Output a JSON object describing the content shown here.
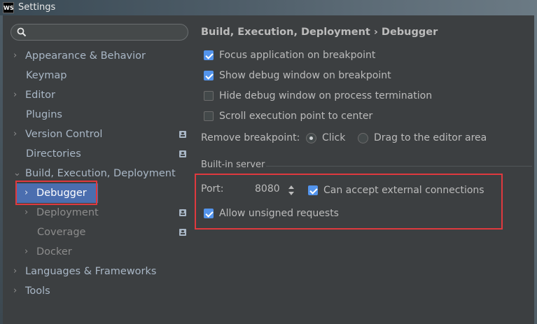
{
  "window": {
    "title": "Settings",
    "logo_text": "WS"
  },
  "search": {
    "placeholder": ""
  },
  "sidebar": {
    "items": [
      {
        "label": "Appearance & Behavior",
        "chevron": "›"
      },
      {
        "label": "Keymap"
      },
      {
        "label": "Editor",
        "chevron": "›"
      },
      {
        "label": "Plugins"
      },
      {
        "label": "Version Control",
        "chevron": "›"
      },
      {
        "label": "Directories"
      },
      {
        "label": "Build, Execution, Deployment",
        "chevron": "⌄"
      },
      {
        "label": "Debugger",
        "chevron": "›"
      },
      {
        "label": "Deployment",
        "chevron": "›"
      },
      {
        "label": "Coverage"
      },
      {
        "label": "Docker",
        "chevron": "›"
      },
      {
        "label": "Languages & Frameworks",
        "chevron": "›"
      },
      {
        "label": "Tools",
        "chevron": "›"
      }
    ]
  },
  "content": {
    "breadcrumb": "Build, Execution, Deployment › Debugger",
    "checkboxes": [
      {
        "label": "Focus application on breakpoint",
        "checked": true
      },
      {
        "label": "Show debug window on breakpoint",
        "checked": true
      },
      {
        "label": "Hide debug window on process termination",
        "checked": false
      },
      {
        "label": "Scroll execution point to center",
        "checked": false
      }
    ],
    "remove_breakpoint": {
      "label": "Remove breakpoint:",
      "options": [
        "Click",
        "Drag to the editor area"
      ],
      "selected": "Click"
    },
    "builtin_server": {
      "title": "Built-in server",
      "port_label": "Port:",
      "port_value": "8080",
      "external_label": "Can accept external connections",
      "external_checked": true,
      "unsigned_label": "Allow unsigned requests",
      "unsigned_checked": true
    }
  },
  "colors": {
    "accent": "#4b6eaf",
    "highlight_box": "#e0393e",
    "checkbox_on": "#5394ec"
  }
}
